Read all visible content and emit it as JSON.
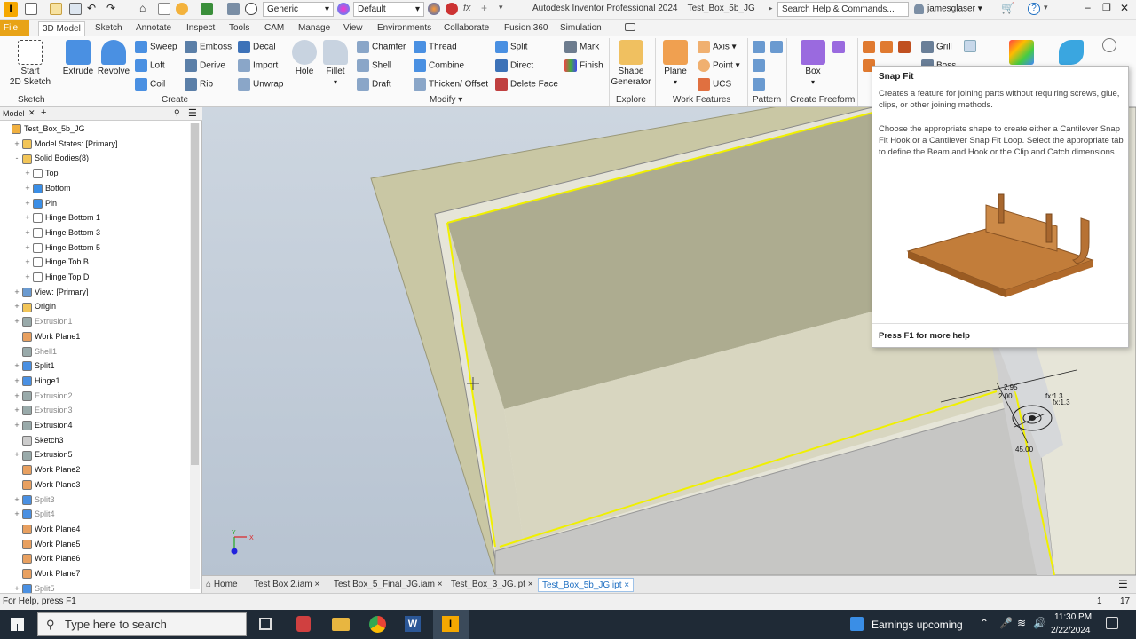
{
  "qat": {
    "appearance": "Generic",
    "material": "Default",
    "app_title": "Autodesk Inventor Professional 2024",
    "doc_title": "Test_Box_5b_JG",
    "search_placeholder": "Search Help & Commands...",
    "user": "jamesglaser"
  },
  "tabs": [
    "File",
    "3D Model",
    "Sketch",
    "Annotate",
    "Inspect",
    "Tools",
    "CAM",
    "Manage",
    "View",
    "Environments",
    "Collaborate",
    "Fusion 360",
    "Simulation"
  ],
  "ribbon": {
    "sketch": {
      "start_line1": "Start",
      "start_line2": "2D Sketch",
      "panel": "Sketch"
    },
    "create": {
      "extrude": "Extrude",
      "revolve": "Revolve",
      "sweep": "Sweep",
      "emboss": "Emboss",
      "decal": "Decal",
      "loft": "Loft",
      "derive": "Derive",
      "import": "Import",
      "coil": "Coil",
      "rib": "Rib",
      "unwrap": "Unwrap",
      "panel": "Create"
    },
    "modify": {
      "hole": "Hole",
      "fillet": "Fillet",
      "chamfer": "Chamfer",
      "thread": "Thread",
      "split": "Split",
      "mark": "Mark",
      "shell": "Shell",
      "combine": "Combine",
      "direct": "Direct",
      "finish": "Finish",
      "draft": "Draft",
      "thicken": "Thicken/ Offset",
      "delete_face": "Delete Face",
      "panel": "Modify"
    },
    "explore": {
      "shape_gen_1": "Shape",
      "shape_gen_2": "Generator",
      "panel": "Explore"
    },
    "work": {
      "plane": "Plane",
      "axis": "Axis",
      "point": "Point",
      "ucs": "UCS",
      "panel": "Work Features"
    },
    "pattern": {
      "panel": "Pattern"
    },
    "freeform": {
      "box": "Box",
      "panel": "Create Freeform"
    },
    "plastic": {
      "grill": "Grill",
      "boss": "Boss"
    }
  },
  "browser": {
    "tab": "Model",
    "add": "+",
    "items": [
      {
        "label": "Test_Box_5b_JG",
        "level": 0,
        "pm": "",
        "icon": "part-icon",
        "dim": false
      },
      {
        "label": "Model States: [Primary]",
        "level": 1,
        "pm": "+",
        "icon": "folder-icon",
        "dim": false
      },
      {
        "label": "Solid Bodies(8)",
        "level": 1,
        "pm": "-",
        "icon": "folder-icon",
        "dim": false
      },
      {
        "label": "Top",
        "level": 2,
        "pm": "+",
        "icon": "wire-body-icon",
        "dim": false
      },
      {
        "label": "Bottom",
        "level": 2,
        "pm": "+",
        "icon": "solid-body-icon",
        "dim": false
      },
      {
        "label": "Pin",
        "level": 2,
        "pm": "+",
        "icon": "solid-body-icon",
        "dim": false
      },
      {
        "label": "Hinge Bottom 1",
        "level": 2,
        "pm": "+",
        "icon": "wire-body-icon",
        "dim": false
      },
      {
        "label": "Hinge Bottom 3",
        "level": 2,
        "pm": "+",
        "icon": "wire-body-icon",
        "dim": false
      },
      {
        "label": "Hinge Bottom 5",
        "level": 2,
        "pm": "+",
        "icon": "wire-body-icon",
        "dim": false
      },
      {
        "label": "Hinge Tob B",
        "level": 2,
        "pm": "+",
        "icon": "wire-body-icon",
        "dim": false
      },
      {
        "label": "Hinge Top D",
        "level": 2,
        "pm": "+",
        "icon": "wire-body-icon",
        "dim": false
      },
      {
        "label": "View: [Primary]",
        "level": 1,
        "pm": "+",
        "icon": "view-icon",
        "dim": false
      },
      {
        "label": "Origin",
        "level": 1,
        "pm": "+",
        "icon": "folder-icon",
        "dim": false
      },
      {
        "label": "Extrusion1",
        "level": 1,
        "pm": "+",
        "icon": "feature-icon",
        "dim": true
      },
      {
        "label": "Work Plane1",
        "level": 1,
        "pm": "",
        "icon": "work-plane-icon",
        "dim": false
      },
      {
        "label": "Shell1",
        "level": 1,
        "pm": "",
        "icon": "feature-icon",
        "dim": true
      },
      {
        "label": "Split1",
        "level": 1,
        "pm": "+",
        "icon": "split-icon",
        "dim": false
      },
      {
        "label": "Hinge1",
        "level": 1,
        "pm": "+",
        "icon": "hinge-icon",
        "dim": false
      },
      {
        "label": "Extrusion2",
        "level": 1,
        "pm": "+",
        "icon": "feature-icon",
        "dim": true
      },
      {
        "label": "Extrusion3",
        "level": 1,
        "pm": "+",
        "icon": "feature-icon",
        "dim": true
      },
      {
        "label": "Extrusion4",
        "level": 1,
        "pm": "+",
        "icon": "feature-icon",
        "dim": false
      },
      {
        "label": "Sketch3",
        "level": 1,
        "pm": "",
        "icon": "sketch-icon",
        "dim": false
      },
      {
        "label": "Extrusion5",
        "level": 1,
        "pm": "+",
        "icon": "feature-icon",
        "dim": false
      },
      {
        "label": "Work Plane2",
        "level": 1,
        "pm": "",
        "icon": "work-plane-icon",
        "dim": false
      },
      {
        "label": "Work Plane3",
        "level": 1,
        "pm": "",
        "icon": "work-plane-icon",
        "dim": false
      },
      {
        "label": "Split3",
        "level": 1,
        "pm": "+",
        "icon": "split-icon",
        "dim": true
      },
      {
        "label": "Split4",
        "level": 1,
        "pm": "+",
        "icon": "split-icon",
        "dim": true
      },
      {
        "label": "Work Plane4",
        "level": 1,
        "pm": "",
        "icon": "work-plane-icon",
        "dim": false
      },
      {
        "label": "Work Plane5",
        "level": 1,
        "pm": "",
        "icon": "work-plane-icon",
        "dim": false
      },
      {
        "label": "Work Plane6",
        "level": 1,
        "pm": "",
        "icon": "work-plane-icon",
        "dim": false
      },
      {
        "label": "Work Plane7",
        "level": 1,
        "pm": "",
        "icon": "work-plane-icon",
        "dim": false
      },
      {
        "label": "Split5",
        "level": 1,
        "pm": "+",
        "icon": "split-icon",
        "dim": true
      }
    ]
  },
  "tooltip": {
    "title": "Snap Fit",
    "desc1": "Creates a feature for joining parts without requiring screws, glue, clips, or other joining methods.",
    "desc2": "Choose the appropriate shape to create either a Cantilever Snap Fit Hook or a Cantilever Snap Fit Loop. Select the appropriate tab to define the Beam and Hook or the Clip and Catch dimensions.",
    "footer": "Press F1 for more help"
  },
  "viewport": {
    "dim1": "2.95",
    "dim2": "2.00",
    "dim3": "fx:1.3",
    "dim4": "fx:1.3",
    "dim5": "45.00",
    "triad_x": "X",
    "triad_y": "Y"
  },
  "doc_tabs": {
    "home": "Home",
    "tabs": [
      "Test Box 2.iam",
      "Test Box_5_Final_JG.iam",
      "Test_Box_3_JG.ipt",
      "Test_Box_5b_JG.ipt"
    ],
    "close": "×"
  },
  "status": {
    "help": "For Help, press F1",
    "count1": "1",
    "count2": "17"
  },
  "taskbar": {
    "search_placeholder": "Type here to search",
    "news": "Earnings upcoming",
    "time": "11:30 PM",
    "date": "2/22/2024"
  },
  "colors": {
    "accent": "#1e6fc2",
    "file_tab": "#e8a317",
    "selection": "#f0f000"
  }
}
